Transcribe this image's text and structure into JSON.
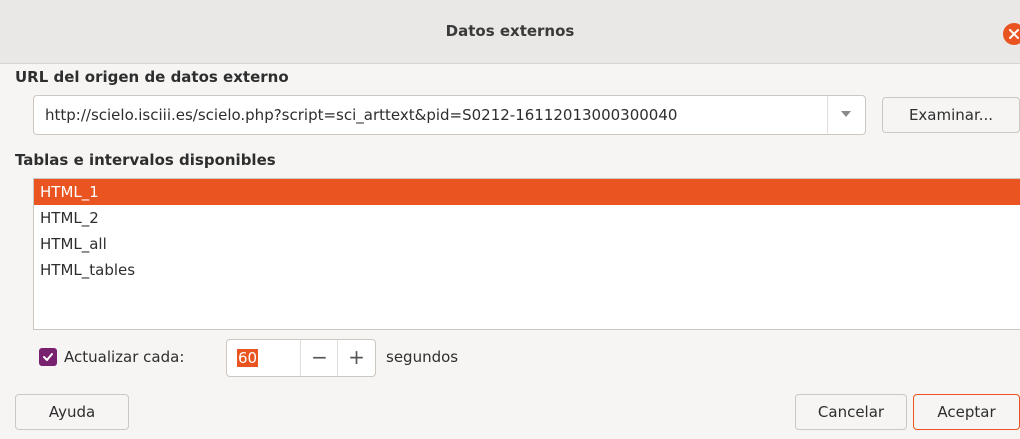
{
  "window": {
    "title": "Datos externos"
  },
  "url_section": {
    "label": "URL del origen de datos externo",
    "url_value": "http://scielo.isciii.es/scielo.php?script=sci_arttext&pid=S0212-16112013000300040",
    "browse_label": "Examinar..."
  },
  "tables_section": {
    "label": "Tablas e intervalos disponibles",
    "items": [
      {
        "label": "HTML_1",
        "selected": true
      },
      {
        "label": "HTML_2",
        "selected": false
      },
      {
        "label": "HTML_all",
        "selected": false
      },
      {
        "label": "HTML_tables",
        "selected": false
      }
    ]
  },
  "update": {
    "checkbox_label": "Actualizar cada:",
    "checked": true,
    "interval_value": "60",
    "unit_label": "segundos",
    "minus_glyph": "−",
    "plus_glyph": "+"
  },
  "buttons": {
    "help": "Ayuda",
    "cancel": "Cancelar",
    "accept": "Aceptar"
  },
  "colors": {
    "accent": "#e95420",
    "checkbox": "#77216f"
  }
}
